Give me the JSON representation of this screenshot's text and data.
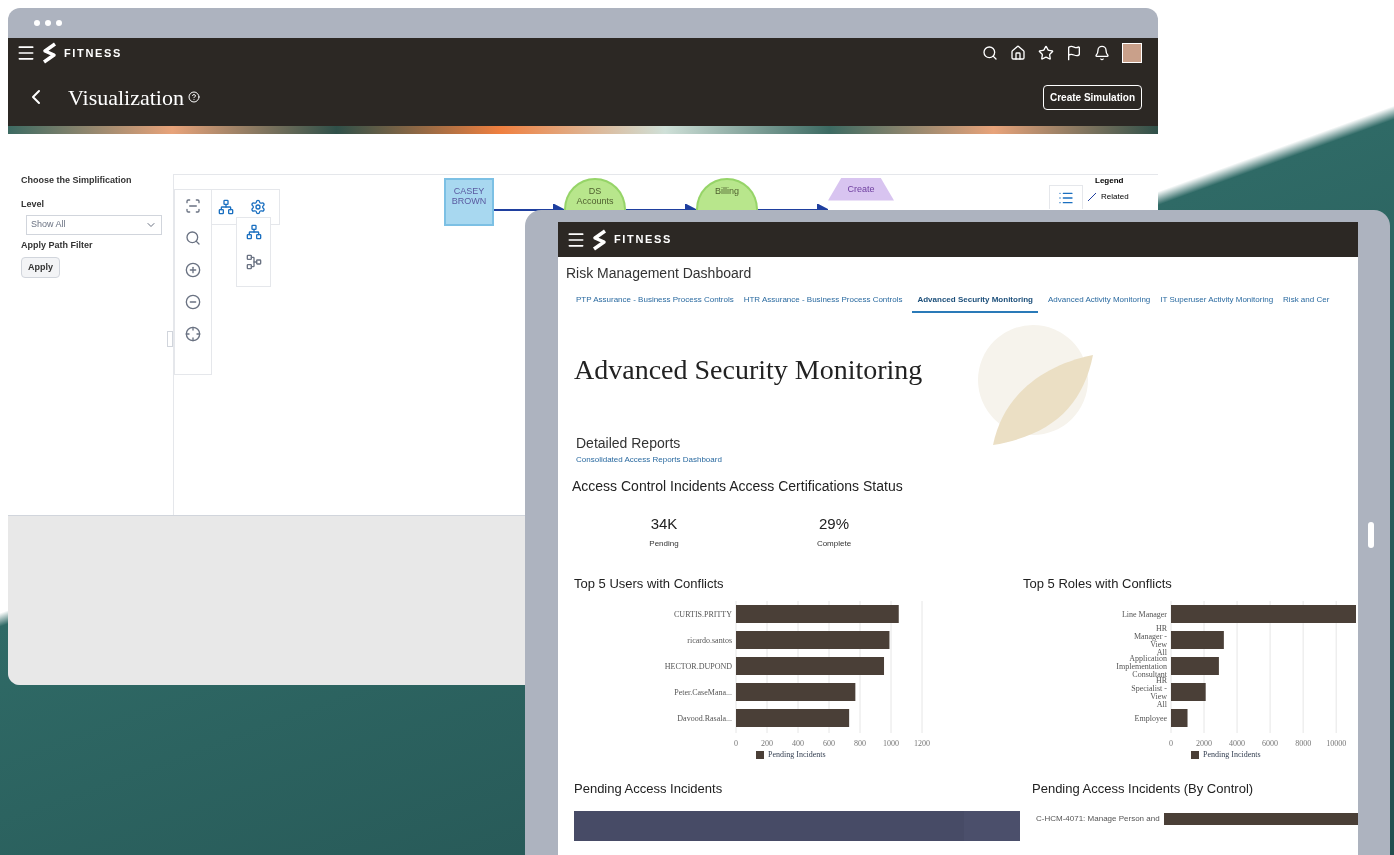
{
  "back_window": {
    "brand": "FITNESS",
    "page_title": "Visualization",
    "create_button": "Create Simulation",
    "filter": {
      "heading": "Choose the Simplification",
      "level_label": "Level",
      "level_value": "Show All",
      "path_label": "Apply Path Filter",
      "apply_button": "Apply"
    },
    "diagram": {
      "nodes": [
        {
          "kind": "person",
          "label": "CASEY BROWN"
        },
        {
          "kind": "account",
          "label": "DS Accounts"
        },
        {
          "kind": "account",
          "label": "Billing"
        },
        {
          "kind": "action",
          "label": "Create"
        }
      ],
      "legend": {
        "title": "Legend",
        "items": [
          "Related"
        ]
      }
    }
  },
  "front_window": {
    "brand": "FITNESS",
    "dashboard_title": "Risk Management Dashboard",
    "tabs": [
      {
        "label": "PTP Assurance - Business Process Controls",
        "selected": false
      },
      {
        "label": "HTR Assurance - Business Process Controls",
        "selected": false
      },
      {
        "label": "Advanced Security Monitoring",
        "selected": true
      },
      {
        "label": "Advanced Activity Monitoring",
        "selected": false
      },
      {
        "label": "IT Superuser Activity Monitoring",
        "selected": false
      },
      {
        "label": "Risk and Cer",
        "selected": false
      }
    ],
    "page_heading": "Advanced Security Monitoring",
    "reports": {
      "title": "Detailed Reports",
      "link": "Consolidated Access Reports Dashboard"
    },
    "stats_heading": "Access Control Incidents Access Certifications Status",
    "stats": [
      {
        "value": "34K",
        "label": "Pending"
      },
      {
        "value": "29%",
        "label": "Complete"
      }
    ],
    "users_chart": {
      "title": "Top 5 Users with Conflicts",
      "chart_data": {
        "type": "bar",
        "orientation": "horizontal",
        "categories": [
          "CURTIS.PRITTY",
          "ricardo.santos",
          "HECTOR.DUPOND",
          "Peter.CaseMana...",
          "Davood.Rasala..."
        ],
        "series": [
          {
            "name": "Pending Incidents",
            "color": "#4a3f37",
            "values": [
              1050,
              990,
              955,
              770,
              730
            ]
          }
        ],
        "xlim": [
          0,
          1200
        ],
        "xticks": [
          0,
          200,
          400,
          600,
          800,
          1000,
          1200
        ],
        "grid": true
      }
    },
    "roles_chart": {
      "title": "Top 5 Roles with Conflicts",
      "chart_data": {
        "type": "bar",
        "orientation": "horizontal",
        "categories": [
          "Line Manager",
          "HR Manager - View All",
          "Application Implementation Consultant",
          "HR Specialist - View All",
          "Employee"
        ],
        "series": [
          {
            "name": "Pending Incidents",
            "color": "#4a3f37",
            "values": [
              11200,
              3200,
              2900,
              2100,
              1000
            ]
          }
        ],
        "xlim": [
          0,
          11200
        ],
        "xticks": [
          0,
          2000,
          4000,
          6000,
          8000,
          10000
        ],
        "grid": true
      }
    },
    "pending_title": "Pending Access Incidents",
    "by_control": {
      "title": "Pending Access Incidents (By Control)",
      "bar_label": "C-HCM-4071: Manage Person and"
    }
  }
}
